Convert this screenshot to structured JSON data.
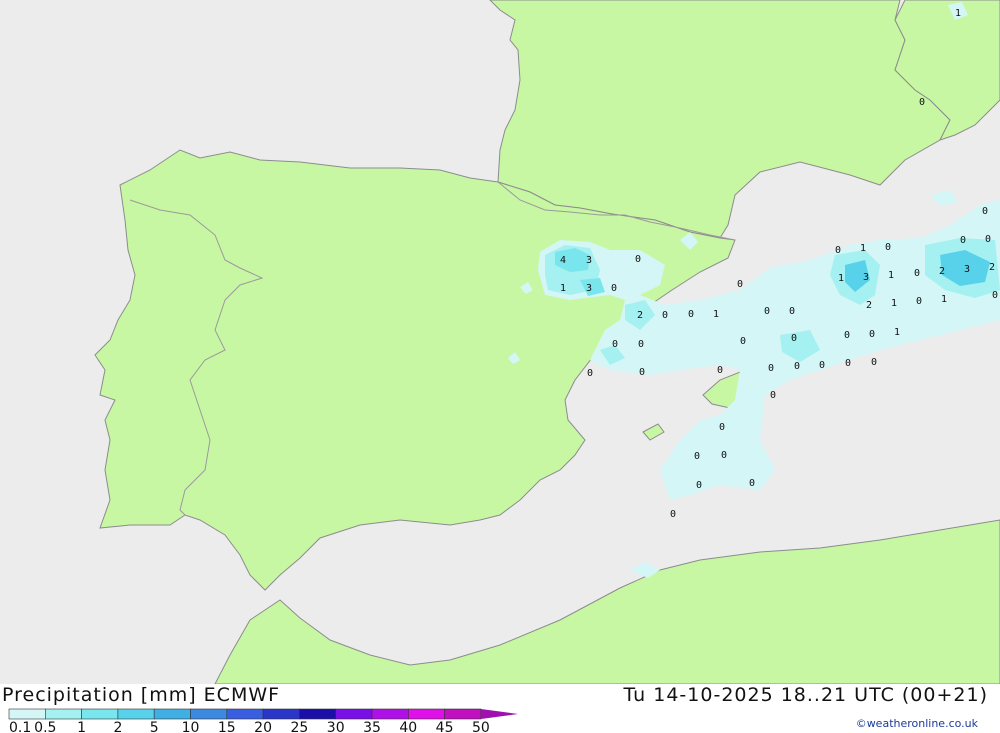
{
  "map": {
    "value_labels": [
      {
        "v": "1"
      },
      {
        "v": "0"
      },
      {
        "v": "4"
      },
      {
        "v": "3"
      },
      {
        "v": "0"
      },
      {
        "v": "1"
      },
      {
        "v": "3"
      },
      {
        "v": "0"
      },
      {
        "v": "2"
      },
      {
        "v": "0"
      },
      {
        "v": "0"
      },
      {
        "v": "1"
      },
      {
        "v": "0"
      },
      {
        "v": "0"
      },
      {
        "v": "0"
      },
      {
        "v": "0"
      },
      {
        "v": "0"
      },
      {
        "v": "0"
      },
      {
        "v": "0"
      },
      {
        "v": "0"
      },
      {
        "v": "0"
      },
      {
        "v": "0"
      },
      {
        "v": "1"
      },
      {
        "v": "0"
      },
      {
        "v": "1"
      },
      {
        "v": "3"
      },
      {
        "v": "1"
      },
      {
        "v": "0"
      },
      {
        "v": "2"
      },
      {
        "v": "3"
      },
      {
        "v": "2"
      },
      {
        "v": "0"
      },
      {
        "v": "0"
      },
      {
        "v": "0"
      },
      {
        "v": "0"
      },
      {
        "v": "2"
      },
      {
        "v": "1"
      },
      {
        "v": "0"
      },
      {
        "v": "1"
      },
      {
        "v": "0"
      },
      {
        "v": "0"
      },
      {
        "v": "1"
      },
      {
        "v": "0"
      },
      {
        "v": "0"
      },
      {
        "v": "0"
      },
      {
        "v": "0"
      },
      {
        "v": "0"
      },
      {
        "v": "0"
      },
      {
        "v": "0"
      },
      {
        "v": "0"
      },
      {
        "v": "0"
      },
      {
        "v": "0"
      },
      {
        "v": "0"
      },
      {
        "v": "0"
      },
      {
        "v": "0"
      }
    ]
  },
  "footer": {
    "title_left": "Precipitation [mm] ECMWF",
    "title_right": "Tu 14-10-2025 18..21 UTC (00+21)",
    "credit": "©weatheronline.co.uk"
  },
  "legend": {
    "labels": [
      "0.1",
      "0.5",
      "1",
      "2",
      "5",
      "10",
      "15",
      "20",
      "25",
      "30",
      "35",
      "40",
      "45",
      "50"
    ],
    "colors": [
      "#d4f6f6",
      "#a5f0f0",
      "#78e6ec",
      "#58d2ea",
      "#40b0e4",
      "#3c8ae0",
      "#3a5ee0",
      "#2a36c8",
      "#1a10a8",
      "#7a10e8",
      "#b010e8",
      "#e010e8",
      "#c010c0"
    ],
    "arrow_color": "#a010b0"
  },
  "colors": {
    "sea": "#ececec",
    "land": "#c8f7a4",
    "coast": "#8c8c8c",
    "border": "#9a9a9a"
  }
}
